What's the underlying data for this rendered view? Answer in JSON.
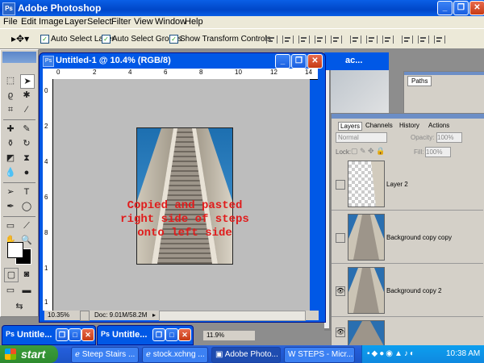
{
  "window": {
    "title": "Adobe Photoshop"
  },
  "menu": [
    "File",
    "Edit",
    "Image",
    "Layer",
    "Select",
    "Filter",
    "View",
    "Window",
    "Help"
  ],
  "options": {
    "auto_select_layer": "Auto Select Layer",
    "auto_select_groups": "Auto Select Groups",
    "show_transform_controls": "Show Transform Controls"
  },
  "document": {
    "title": "Untitled-1 @ 10.4% (RGB/8)",
    "caption": [
      "Copied and pasted",
      "right side of steps",
      "onto left side"
    ],
    "zoom": "10.35%",
    "doc_info": "Doc: 9.01M/58.2M",
    "ruler_h": [
      "0",
      "2",
      "4",
      "6",
      "8",
      "10",
      "12",
      "14"
    ],
    "ruler_v": [
      "0",
      "2",
      "4",
      "6",
      "8",
      "1",
      "1"
    ]
  },
  "background_window": {
    "title_fragment": "ac...",
    "zoom": "11.9%"
  },
  "paths_palette": {
    "tab": "Paths"
  },
  "layers_palette": {
    "tabs": [
      "Layers",
      "Channels",
      "History",
      "Actions"
    ],
    "blend_mode": "Normal",
    "opacity_label": "Opacity:",
    "opacity_value": "100%",
    "lock_label": "Lock:",
    "fill_label": "Fill:",
    "fill_value": "100%",
    "layers": [
      {
        "name": "Layer 2",
        "visible": false
      },
      {
        "name": "Background copy  copy",
        "visible": false
      },
      {
        "name": "Background copy 2",
        "visible": true
      },
      {
        "name": "",
        "visible": true
      }
    ]
  },
  "minimized_windows": [
    "Untitle...",
    "Untitle..."
  ],
  "taskbar": {
    "start": "start",
    "tasks": [
      "Steep Stairs ...",
      "stock.xchng ...",
      "Adobe Photo...",
      "STEPS - Micr..."
    ],
    "clock": "10:38 AM"
  }
}
